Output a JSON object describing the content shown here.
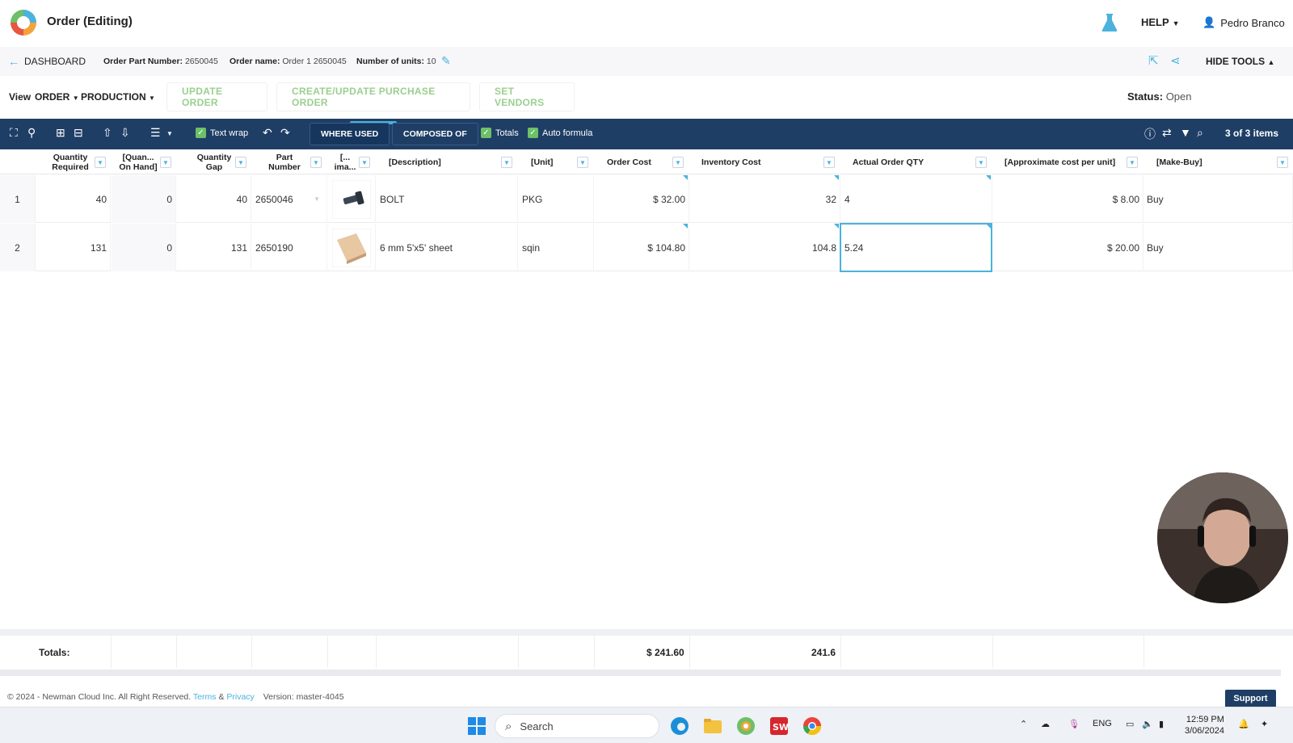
{
  "header": {
    "title": "Order (Editing)",
    "help_label": "HELP",
    "user_name": "Pedro Branco"
  },
  "breadcrumb": {
    "back_label": "DASHBOARD",
    "order_part_number_label": "Order Part Number:",
    "order_part_number": "2650045",
    "order_name_label": "Order name:",
    "order_name": "Order 1 2650045",
    "units_label": "Number of units:",
    "units": "10",
    "hide_tools_label": "HIDE TOOLS"
  },
  "actions": {
    "view_label": "View",
    "view_order": "ORDER",
    "view_production": "PRODUCTION",
    "update_order": "UPDATE ORDER",
    "create_po": "CREATE/UPDATE PURCHASE ORDER",
    "set_vendors": "SET VENDORS",
    "status_label": "Status:",
    "status_value": "Open"
  },
  "toolbar": {
    "text_wrap": "Text wrap",
    "where_used": "WHERE USED",
    "composed_of": "COMPOSED OF",
    "totals": "Totals",
    "auto_formula": "Auto formula",
    "count": "3 of 3 items"
  },
  "columns": [
    {
      "l1": "Quantity",
      "l2": "Required"
    },
    {
      "l1": "[Quan...",
      "l2": "On Hand]"
    },
    {
      "l1": "Quantity",
      "l2": "Gap"
    },
    {
      "l1": "Part",
      "l2": "Number"
    },
    {
      "l1": "[...",
      "l2": "ima..."
    },
    {
      "l1": "[Description]",
      "l2": ""
    },
    {
      "l1": "[Unit]",
      "l2": ""
    },
    {
      "l1": "Order Cost",
      "l2": ""
    },
    {
      "l1": "Inventory Cost",
      "l2": ""
    },
    {
      "l1": "Actual Order QTY",
      "l2": ""
    },
    {
      "l1": "[Approximate cost per unit]",
      "l2": ""
    },
    {
      "l1": "[Make-Buy]",
      "l2": ""
    }
  ],
  "rows": [
    {
      "idx": "1",
      "qty_req": "40",
      "on_hand": "0",
      "gap": "40",
      "part": "2650046",
      "desc": "BOLT",
      "unit": "PKG",
      "order_cost": "$ 32.00",
      "inv_cost": "32",
      "actual_qty": "4",
      "approx": "$ 8.00",
      "make_buy": "Buy"
    },
    {
      "idx": "2",
      "qty_req": "131",
      "on_hand": "0",
      "gap": "131",
      "part": "2650190",
      "desc": "6 mm 5'x5' sheet",
      "unit": "sqin",
      "order_cost": "$ 104.80",
      "inv_cost": "104.8",
      "actual_qty": "5.24",
      "approx": "$ 20.00",
      "make_buy": "Buy"
    }
  ],
  "totals": {
    "label": "Totals:",
    "order_cost": "$ 241.60",
    "inventory_cost": "241.6"
  },
  "footer": {
    "copyright": "© 2024 - Newman Cloud Inc. All Right Reserved.",
    "terms": "Terms",
    "amp": "&",
    "privacy": "Privacy",
    "version": "Version: master-4045",
    "support": "Support"
  },
  "taskbar": {
    "search_placeholder": "Search",
    "lang": "ENG",
    "time": "12:59 PM",
    "date": "3/06/2024"
  },
  "colors": {
    "navy": "#1f3e66",
    "accent": "#4ab2dd",
    "green": "#9bcf8f"
  }
}
